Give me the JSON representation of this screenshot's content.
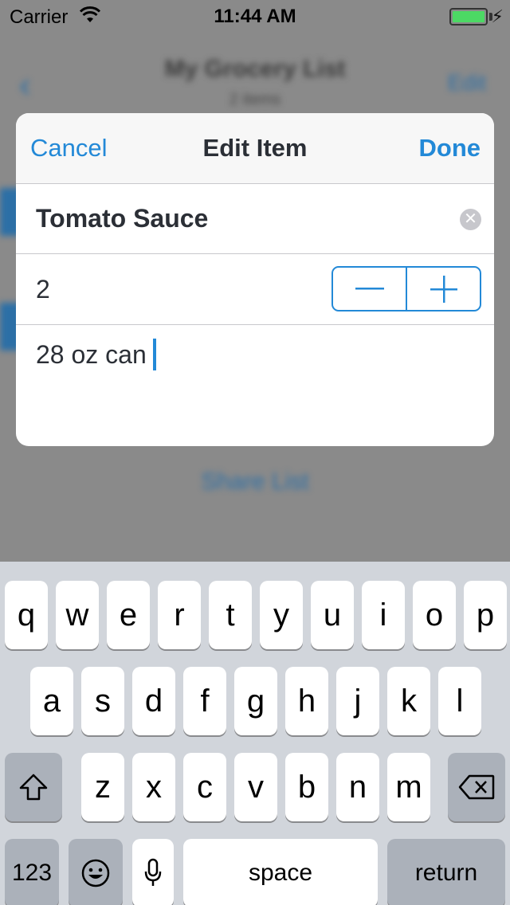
{
  "status_bar": {
    "carrier": "Carrier",
    "time": "11:44 AM"
  },
  "background": {
    "title": "My Grocery List",
    "subtitle": "2 items",
    "edit_label": "Edit",
    "share_label": "Share List"
  },
  "dialog": {
    "cancel_label": "Cancel",
    "title": "Edit Item",
    "done_label": "Done",
    "item_name": "Tomato Sauce",
    "quantity": "2",
    "note": "28 oz can"
  },
  "keyboard": {
    "row1": [
      "q",
      "w",
      "e",
      "r",
      "t",
      "y",
      "u",
      "i",
      "o",
      "p"
    ],
    "row2": [
      "a",
      "s",
      "d",
      "f",
      "g",
      "h",
      "j",
      "k",
      "l"
    ],
    "row3": [
      "z",
      "x",
      "c",
      "v",
      "b",
      "n",
      "m"
    ],
    "numbers_label": "123",
    "space_label": "space",
    "return_label": "return"
  },
  "colors": {
    "accent": "#2389d7",
    "battery": "#4cd964"
  },
  "icons": [
    "wifi-icon",
    "battery-icon",
    "charging-bolt-icon",
    "clear-icon",
    "minus-icon",
    "plus-icon",
    "shift-icon",
    "delete-icon",
    "emoji-icon",
    "microphone-icon"
  ]
}
